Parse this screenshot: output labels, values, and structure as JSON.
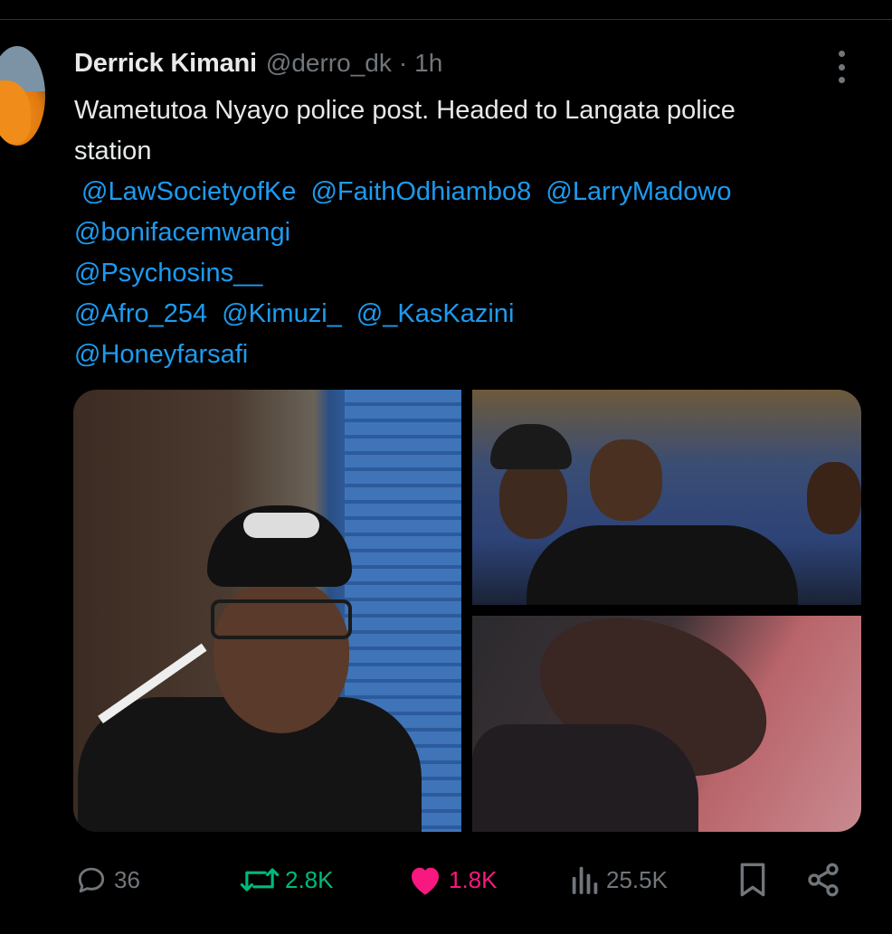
{
  "post": {
    "author_name": "Derrick Kimani",
    "handle": "@derro_dk",
    "separator": "·",
    "time": "1h",
    "text_lines": [
      "Wametutoa Nyayo police post. Headed to Langata police",
      "station"
    ],
    "mentions": [
      "@LawSocietyofKe",
      "@FaithOdhiambo8",
      "@LarryMadowo",
      "@bonifacemwangi",
      "@Psychosins__",
      "@Afro_254",
      "@Kimuzi_",
      "@_KasKazini",
      "@Honeyfarsafi"
    ]
  },
  "actions": {
    "replies": "36",
    "reposts": "2.8K",
    "likes": "1.8K",
    "views": "25.5K"
  },
  "icons": {
    "reply": "reply-icon",
    "repost": "repost-icon",
    "like": "heart-icon",
    "views": "views-icon",
    "bookmark": "bookmark-icon",
    "share": "share-icon",
    "more": "more-icon"
  },
  "colors": {
    "background": "#000000",
    "text": "#e7e9ea",
    "secondary": "#71767b",
    "mention": "#1d9bf0",
    "repost_active": "#00ba7c",
    "like_active": "#f91880"
  }
}
